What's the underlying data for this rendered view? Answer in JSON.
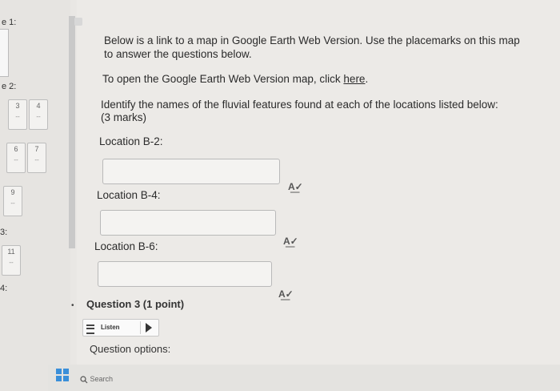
{
  "sidebar": {
    "sections": [
      {
        "label": "e 1:"
      },
      {
        "label": "e 2:"
      },
      {
        "label": "3:"
      },
      {
        "label": "4:"
      }
    ],
    "questions": [
      {
        "num": "3",
        "dash": "--"
      },
      {
        "num": "4",
        "dash": "--"
      },
      {
        "num": "6",
        "dash": "--"
      },
      {
        "num": "7",
        "dash": "--"
      },
      {
        "num": "9",
        "dash": "--"
      },
      {
        "num": "11",
        "dash": "--"
      }
    ]
  },
  "question2": {
    "intro": "Below is a link to a map in Google Earth Web Version. Use the placemarks on this map to answer the questions below.",
    "open_prefix": "To open the Google Earth Web Version map, click ",
    "open_link": "here",
    "open_suffix": ".",
    "instruction": "Identify the names of the fluvial features found at each of the locations listed below:",
    "marks": "(3 marks)",
    "fields": [
      {
        "label": "Location B-2:",
        "value": ""
      },
      {
        "label": "Location B-4:",
        "value": ""
      },
      {
        "label": "Location B-6:",
        "value": ""
      }
    ],
    "spellcheck_icon": "spellcheck-icon"
  },
  "question3": {
    "title": "Question 3 (1 point)",
    "listen_label": "Listen",
    "options_label": "Question options:"
  },
  "taskbar": {
    "search_label": "Search"
  },
  "colors": {
    "windows_blue": "#3a8fd9",
    "background": "#eceae7"
  }
}
